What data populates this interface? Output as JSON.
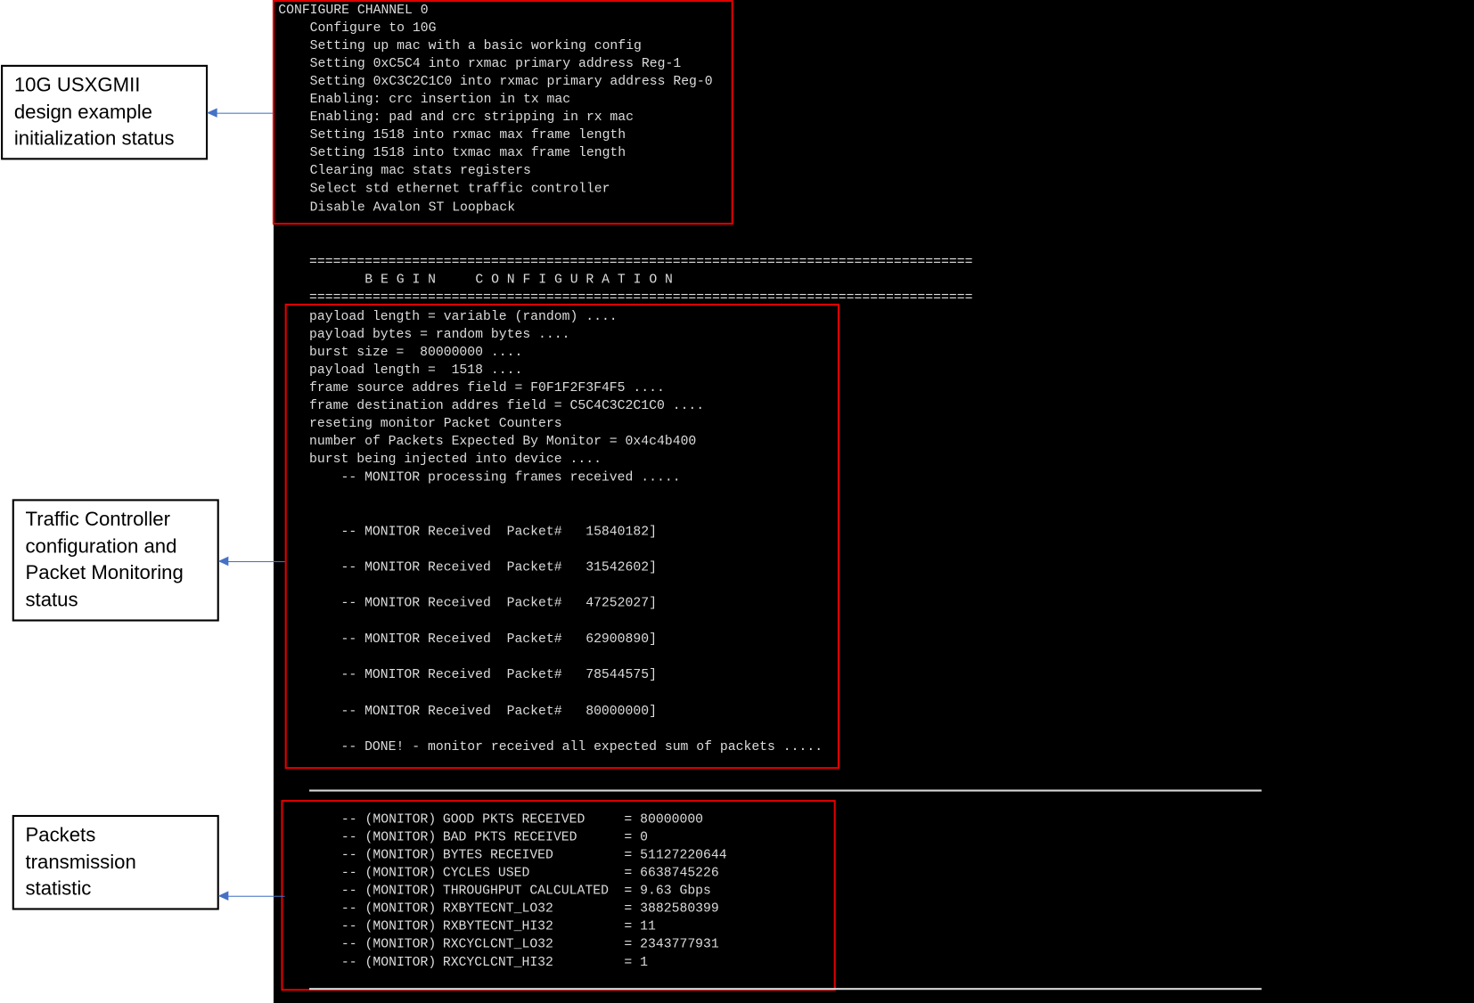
{
  "init": {
    "title": "CONFIGURE CHANNEL 0",
    "lines": [
      "Configure to 10G",
      "Setting up mac with a basic working config",
      "Setting 0xC5C4 into rxmac primary address Reg-1",
      "Setting 0xC3C2C1C0 into rxmac primary address Reg-0",
      "Enabling: crc insertion in tx mac",
      "Enabling: pad and crc stripping in rx mac",
      "Setting 1518 into rxmac max frame length",
      "Setting 1518 into txmac max frame length",
      "Clearing mac stats registers",
      "Select std ethernet traffic controller",
      "Disable Avalon ST Loopback"
    ]
  },
  "banner": {
    "rule": "====================================================================================",
    "heading": "B E G I N     C O N F I G U R A T I O N"
  },
  "config": {
    "lines": [
      "payload length = variable (random) ....",
      "payload bytes = random bytes ....",
      "burst size =  80000000 ....",
      "payload length =  1518 ....",
      "frame source addres field = F0F1F2F3F4F5 ....",
      "frame destination addres field = C5C4C3C2C1C0 ....",
      "reseting monitor Packet Counters",
      "number of Packets Expected By Monitor = 0x4c4b400",
      "burst being injected into device ...."
    ],
    "processing": "-- MONITOR processing frames received .....",
    "received": [
      "-- MONITOR Received  Packet#   15840182]",
      "-- MONITOR Received  Packet#   31542602]",
      "-- MONITOR Received  Packet#   47252027]",
      "-- MONITOR Received  Packet#   62900890]",
      "-- MONITOR Received  Packet#   78544575]",
      "-- MONITOR Received  Packet#   80000000]"
    ],
    "done": "-- DONE! - monitor received all expected sum of packets ....."
  },
  "stats": {
    "prefix": "-- (MONITOR)",
    "rows": [
      {
        "label": "GOOD PKTS RECEIVED",
        "value": "= 80000000"
      },
      {
        "label": "BAD PKTS RECEIVED",
        "value": "= 0"
      },
      {
        "label": "BYTES RECEIVED",
        "value": "= 51127220644"
      },
      {
        "label": "CYCLES USED",
        "value": "= 6638745226"
      },
      {
        "label": "THROUGHPUT CALCULATED",
        "value": "= 9.63 Gbps"
      },
      {
        "label": "RXBYTECNT_LO32",
        "value": "= 3882580399"
      },
      {
        "label": "RXBYTECNT_HI32",
        "value": "= 11"
      },
      {
        "label": "RXCYCLCNT_LO32",
        "value": "= 2343777931"
      },
      {
        "label": "RXCYCLCNT_HI32",
        "value": "= 1"
      }
    ]
  },
  "annotations": {
    "init": [
      "10G USXGMII",
      "design example",
      "initialization status"
    ],
    "traffic": [
      "Traffic Controller",
      "configuration and",
      "Packet Monitoring",
      "status"
    ],
    "stats": [
      "Packets",
      "transmission",
      "statistic"
    ]
  },
  "colors": {
    "terminal_bg": "#000000",
    "highlight": "#e00000",
    "arrow": "#4472c4"
  }
}
